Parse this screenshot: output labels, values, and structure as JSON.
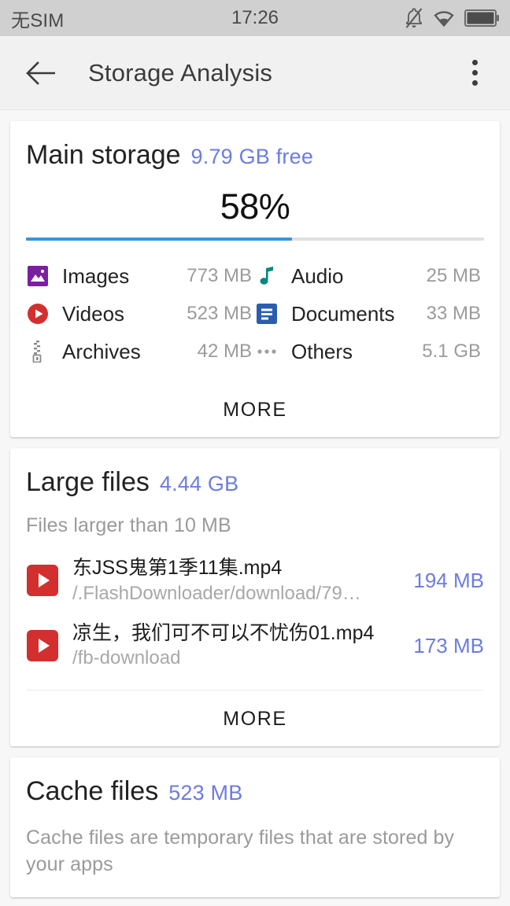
{
  "statusbar": {
    "carrier": "无SIM",
    "clock": "17:26",
    "icons": [
      "bell-muted-icon",
      "wifi-icon",
      "battery-icon"
    ]
  },
  "appbar": {
    "back_icon": "back-arrow-icon",
    "title": "Storage Analysis",
    "overflow_icon": "overflow-menu-icon"
  },
  "colors": {
    "accent_blue": "#6c7ce0",
    "progress_fill": "#3b95d6",
    "progress_track": "#e0e0e0",
    "images_icon": "#7b1fa2",
    "videos_icon": "#d32f2f",
    "audio_icon": "#00897b",
    "documents_icon": "#2a5db0",
    "archives_icon": "#8a8a8a",
    "others_icon": "#9e9e9e",
    "card_bg": "#ffffff",
    "page_bg": "#f7f7f7"
  },
  "main_storage": {
    "title": "Main storage",
    "free": "9.79 GB free",
    "percent_label": "58%",
    "percent_value": 58,
    "categories": [
      {
        "icon": "image-icon",
        "label": "Images",
        "size": "773 MB"
      },
      {
        "icon": "audio-icon",
        "label": "Audio",
        "size": "25 MB"
      },
      {
        "icon": "video-icon",
        "label": "Videos",
        "size": "523 MB"
      },
      {
        "icon": "document-icon",
        "label": "Documents",
        "size": "33 MB"
      },
      {
        "icon": "archive-icon",
        "label": "Archives",
        "size": "42 MB"
      },
      {
        "icon": "others-icon",
        "label": "Others",
        "size": "5.1 GB"
      }
    ],
    "more_label": "MORE"
  },
  "large_files": {
    "title": "Large files",
    "total": "4.44 GB",
    "subtitle": "Files larger than 10 MB",
    "files": [
      {
        "icon": "video-file-icon",
        "name": "东JSS鬼第1季11集.mp4",
        "path": "/.FlashDownloader/download/79…",
        "size": "194 MB"
      },
      {
        "icon": "video-file-icon",
        "name": "凉生，我们可不可以不忧伤01.mp4",
        "path": "/fb-download",
        "size": "173 MB"
      }
    ],
    "more_label": "MORE"
  },
  "cache_files": {
    "title": "Cache files",
    "total": "523 MB",
    "description": "Cache files are temporary files that are stored by your apps"
  }
}
